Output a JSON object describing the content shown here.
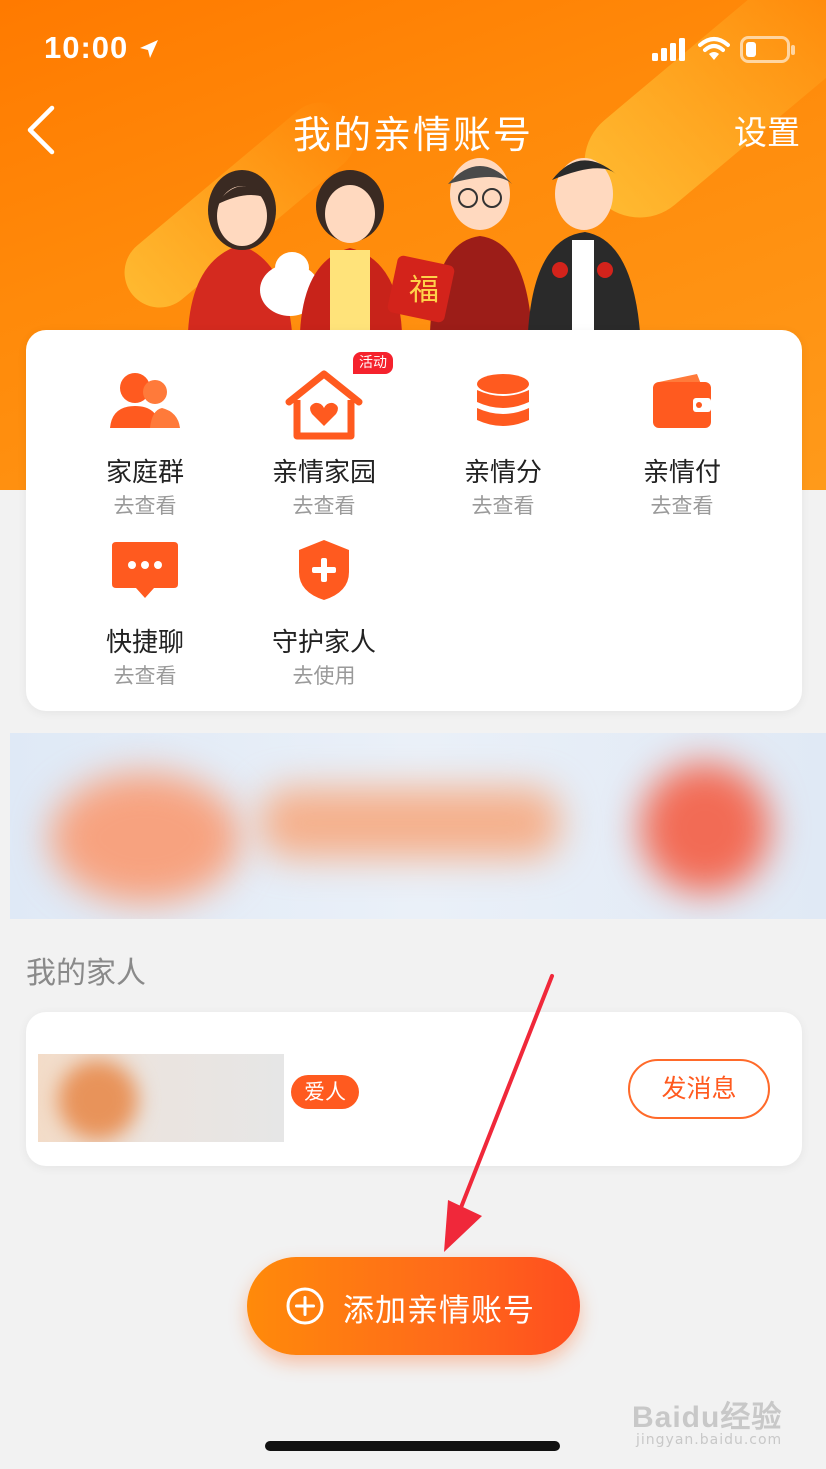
{
  "status_bar": {
    "time": "10:00"
  },
  "nav": {
    "title": "我的亲情账号",
    "settings_label": "设置"
  },
  "menu": {
    "items": [
      {
        "label": "家庭群",
        "sub": "去查看",
        "icon": "people-icon"
      },
      {
        "label": "亲情家园",
        "sub": "去查看",
        "icon": "heart-house-icon",
        "badge": "活动"
      },
      {
        "label": "亲情分",
        "sub": "去查看",
        "icon": "coin-stack-icon"
      },
      {
        "label": "亲情付",
        "sub": "去查看",
        "icon": "wallet-icon"
      },
      {
        "label": "快捷聊",
        "sub": "去查看",
        "icon": "chat-bubble-icon"
      },
      {
        "label": "守护家人",
        "sub": "去使用",
        "icon": "shield-plus-icon"
      }
    ]
  },
  "family": {
    "section_title": "我的家人",
    "members": [
      {
        "relation": "爱人",
        "action_label": "发消息"
      }
    ]
  },
  "add_button": {
    "label": "添加亲情账号"
  },
  "watermark": {
    "main": "Baidu经验",
    "sub": "jingyan.baidu.com"
  },
  "colors": {
    "accent": "#ff6a1a",
    "hero": "#ff8a0a",
    "badge": "#f5222d"
  }
}
